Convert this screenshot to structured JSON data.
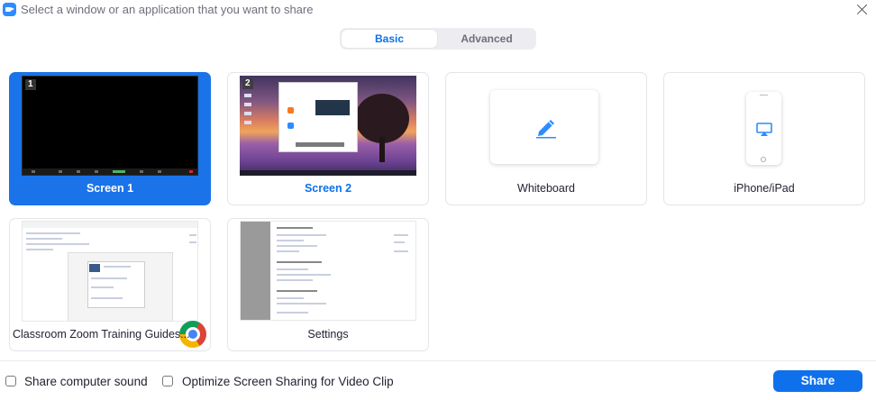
{
  "window": {
    "title": "Select a window or an application that you want to share",
    "close_icon": "close-icon"
  },
  "tabs": [
    {
      "label": "Basic",
      "selected": true
    },
    {
      "label": "Advanced",
      "selected": false
    }
  ],
  "share_items": [
    {
      "label": "Screen 1",
      "badge": "1",
      "selected": true
    },
    {
      "label": "Screen 2",
      "badge": "2",
      "selected": false
    },
    {
      "label": "Whiteboard",
      "icon": "pencil-icon"
    },
    {
      "label": "iPhone/iPad",
      "icon": "airplay-icon"
    },
    {
      "label": "Classroom Zoom Training Guides...",
      "app_icon": "chrome-icon"
    },
    {
      "label": "Settings"
    }
  ],
  "footer": {
    "share_sound_label": "Share computer sound",
    "share_sound_checked": false,
    "optimize_label": "Optimize Screen Sharing for Video Clip",
    "optimize_checked": false,
    "share_button": "Share"
  },
  "colors": {
    "accent": "#0E71EB",
    "selected_card": "#1a73e8"
  }
}
